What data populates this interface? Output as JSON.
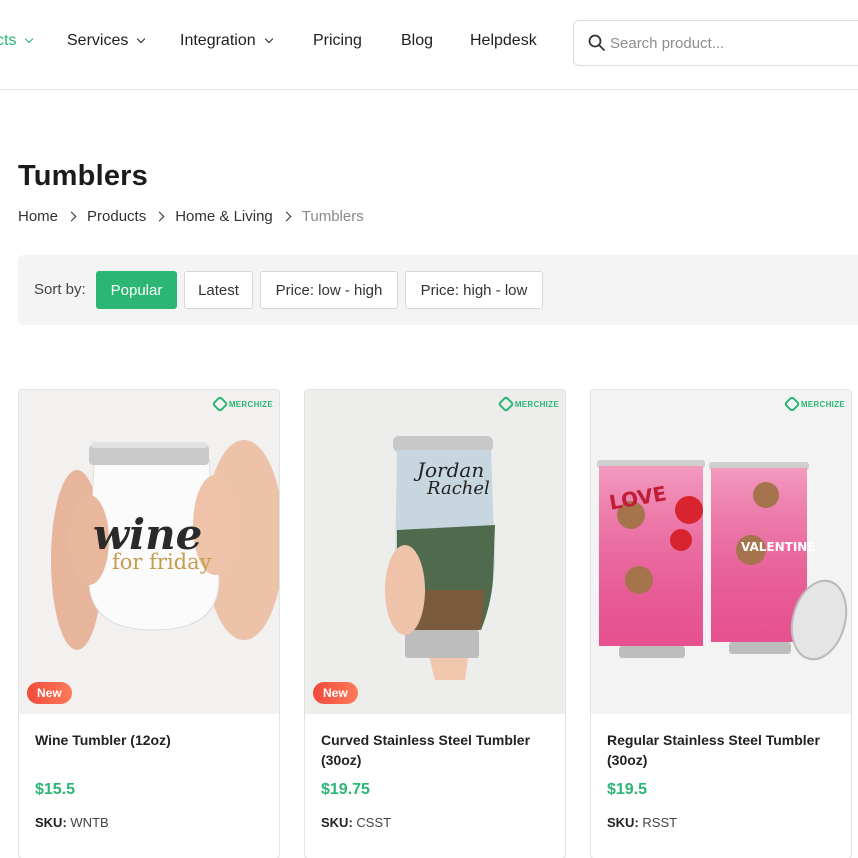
{
  "nav": {
    "items": [
      {
        "label": "cts",
        "has_dropdown": true,
        "active": true
      },
      {
        "label": "Services",
        "has_dropdown": true
      },
      {
        "label": "Integration",
        "has_dropdown": true
      },
      {
        "label": "Pricing",
        "has_dropdown": false
      },
      {
        "label": "Blog",
        "has_dropdown": false
      },
      {
        "label": "Helpdesk",
        "has_dropdown": false
      }
    ],
    "search_placeholder": "Search product..."
  },
  "page": {
    "title": "Tumblers",
    "breadcrumb": [
      "Home",
      "Products",
      "Home & Living",
      "Tumblers"
    ]
  },
  "sort": {
    "label": "Sort by:",
    "options": [
      "Popular",
      "Latest",
      "Price: low - high",
      "Price: high - low"
    ],
    "selected": "Popular"
  },
  "products": [
    {
      "name": "Wine Tumbler (12oz)",
      "price": "$15.5",
      "sku_label": "SKU:",
      "sku": "WNTB",
      "badge": "New",
      "brand": "MERCHIZE",
      "image_text_1": "wine",
      "image_text_2": "for friday"
    },
    {
      "name": "Curved Stainless Steel Tumbler (30oz)",
      "price": "$19.75",
      "sku_label": "SKU:",
      "sku": "CSST",
      "badge": "New",
      "brand": "MERCHIZE",
      "image_text_1": "Jordan",
      "image_text_2": "Rachel"
    },
    {
      "name": "Regular Stainless Steel Tumbler (30oz)",
      "price": "$19.5",
      "sku_label": "SKU:",
      "sku": "RSST",
      "badge": "",
      "brand": "MERCHIZE",
      "image_text_1": "LOVE",
      "image_text_2": "VALENTINE"
    }
  ],
  "colors": {
    "accent": "#2bb673",
    "badge": "#f04a3a"
  }
}
